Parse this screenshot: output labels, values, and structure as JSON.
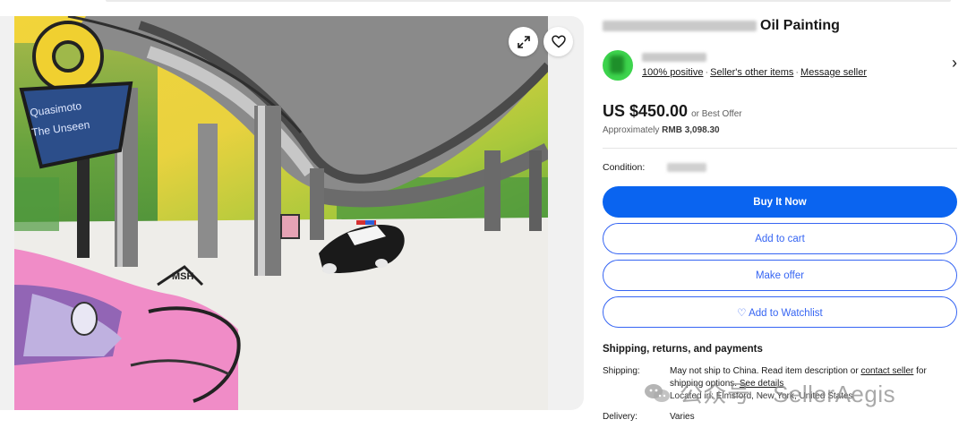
{
  "gallery": {
    "painting": {
      "sign_text_top": "Quasimoto",
      "sign_text_bottom": "The Unseen",
      "sign_letter": "Q",
      "signature": "MSH"
    },
    "expand_icon": "expand-icon",
    "heart_icon": "heart-icon"
  },
  "listing": {
    "title_visible": "Oil Painting",
    "seller": {
      "feedback": "100% positive",
      "other_items": "Seller's other items",
      "message": "Message seller"
    },
    "price": "US $450.00",
    "best_offer": "or Best Offer",
    "approx_label": "Approximately",
    "approx_value": "RMB 3,098.30",
    "condition_label": "Condition:",
    "buttons": {
      "buy_now": "Buy It Now",
      "add_to_cart": "Add to cart",
      "make_offer": "Make offer",
      "watchlist": "♡ Add to Watchlist"
    },
    "shipping": {
      "section_title": "Shipping, returns, and payments",
      "shipping_label": "Shipping:",
      "shipping_text_1": "May not ship to China. Read item description or",
      "contact_seller": "contact seller",
      "shipping_text_2": "for shipping options.",
      "see_details": "See details",
      "location": "Located in: Elmsford, New York, United States",
      "delivery_label": "Delivery:",
      "delivery_value": "Varies"
    }
  },
  "watermark": {
    "text": "公众号 · SellerAegis"
  },
  "colors": {
    "primary_blue": "#0a64f0",
    "outline_blue": "#3665f3",
    "avatar_green": "#3dd44d"
  }
}
